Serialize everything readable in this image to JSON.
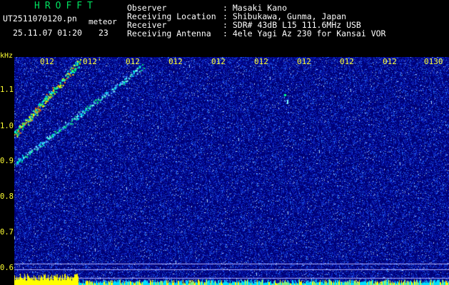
{
  "header": {
    "logo": "HROFFT",
    "filename": "UT2511070120.pn",
    "tag": "meteor",
    "datetime": "25.11.07 01:20",
    "count": "23",
    "rows": [
      {
        "label": "Observer",
        "value": ": Masaki Kano"
      },
      {
        "label": "Receiving Location",
        "value": ": Shibukawa, Gunma, Japan"
      },
      {
        "label": "Receiver",
        "value": ": SDR# 43dB L15 111.6MHz USB"
      },
      {
        "label": "Receiving Antenna",
        "value": ": 4ele Yagi Az 230 for Kansai VOR"
      }
    ]
  },
  "spectrogram": {
    "y_unit": "kHz",
    "y_ticks": [
      "1.1",
      "1.0",
      "0.9",
      "0.8",
      "0.7",
      "0.6"
    ],
    "x_ticks": [
      "012",
      "012'",
      "012",
      "012",
      "012",
      "012",
      "012",
      "012",
      "012",
      "0130"
    ],
    "colors": {
      "background": "#000066",
      "noise": "#3050ff",
      "signal": "#ffff00",
      "label": "#ffff33",
      "baseline": "#00e0ff"
    }
  }
}
